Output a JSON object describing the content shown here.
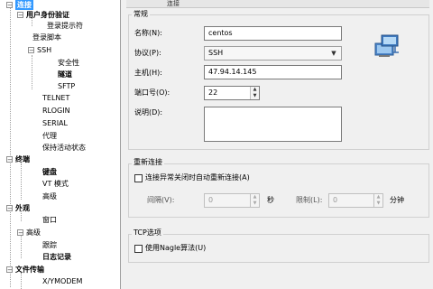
{
  "tree": {
    "items": [
      {
        "label": "连接",
        "level": 0,
        "bold": true,
        "selected": true,
        "expanded": true
      },
      {
        "label": "用户身份验证",
        "level": 1,
        "bold": true,
        "expanded": true
      },
      {
        "label": "登录提示符",
        "level": 2
      },
      {
        "label": "登录脚本",
        "level": 1
      },
      {
        "label": "SSH",
        "level": 1,
        "expanded": true
      },
      {
        "label": "安全性",
        "level": 2
      },
      {
        "label": "隧道",
        "level": 2,
        "bold": true
      },
      {
        "label": "SFTP",
        "level": 2
      },
      {
        "label": "TELNET",
        "level": 1
      },
      {
        "label": "RLOGIN",
        "level": 1
      },
      {
        "label": "SERIAL",
        "level": 1
      },
      {
        "label": "代理",
        "level": 1
      },
      {
        "label": "保持活动状态",
        "level": 1
      },
      {
        "label": "终端",
        "level": 0,
        "bold": true,
        "expanded": true
      },
      {
        "label": "键盘",
        "level": 1,
        "bold": true
      },
      {
        "label": "VT 模式",
        "level": 1
      },
      {
        "label": "高级",
        "level": 1
      },
      {
        "label": "外观",
        "level": 0,
        "bold": true,
        "expanded": true
      },
      {
        "label": "窗口",
        "level": 1
      },
      {
        "label": "高级",
        "level": 0,
        "expanded": true
      },
      {
        "label": "跟踪",
        "level": 1
      },
      {
        "label": "日志记录",
        "level": 1,
        "bold": true
      },
      {
        "label": "文件传输",
        "level": 0,
        "bold": true,
        "expanded": true
      },
      {
        "label": "X/YMODEM",
        "level": 1
      }
    ]
  },
  "panel": {
    "title": "连接",
    "general": {
      "title": "常规",
      "name_label": "名称(N):",
      "name_value": "centos",
      "protocol_label": "协议(P):",
      "protocol_value": "SSH",
      "host_label": "主机(H):",
      "host_value": "47.94.14.145",
      "port_label": "端口号(O):",
      "port_value": "22",
      "desc_label": "说明(D):",
      "desc_value": ""
    },
    "reconnect": {
      "title": "重新连接",
      "auto_label": "连接异常关闭时自动重新连接(A)",
      "interval_label": "间隔(V):",
      "interval_value": "0",
      "seconds_unit": "秒",
      "limit_label": "限制(L):",
      "limit_value": "0",
      "minutes_unit": "分钟"
    },
    "tcp": {
      "title": "TCP选项",
      "nagle_label": "使用Nagle算法(U)"
    }
  },
  "colors": {
    "selection": "#3399ff",
    "window_bg": "#f0f0f0"
  },
  "icons": {
    "connection_icon": "network-computer-icon"
  }
}
